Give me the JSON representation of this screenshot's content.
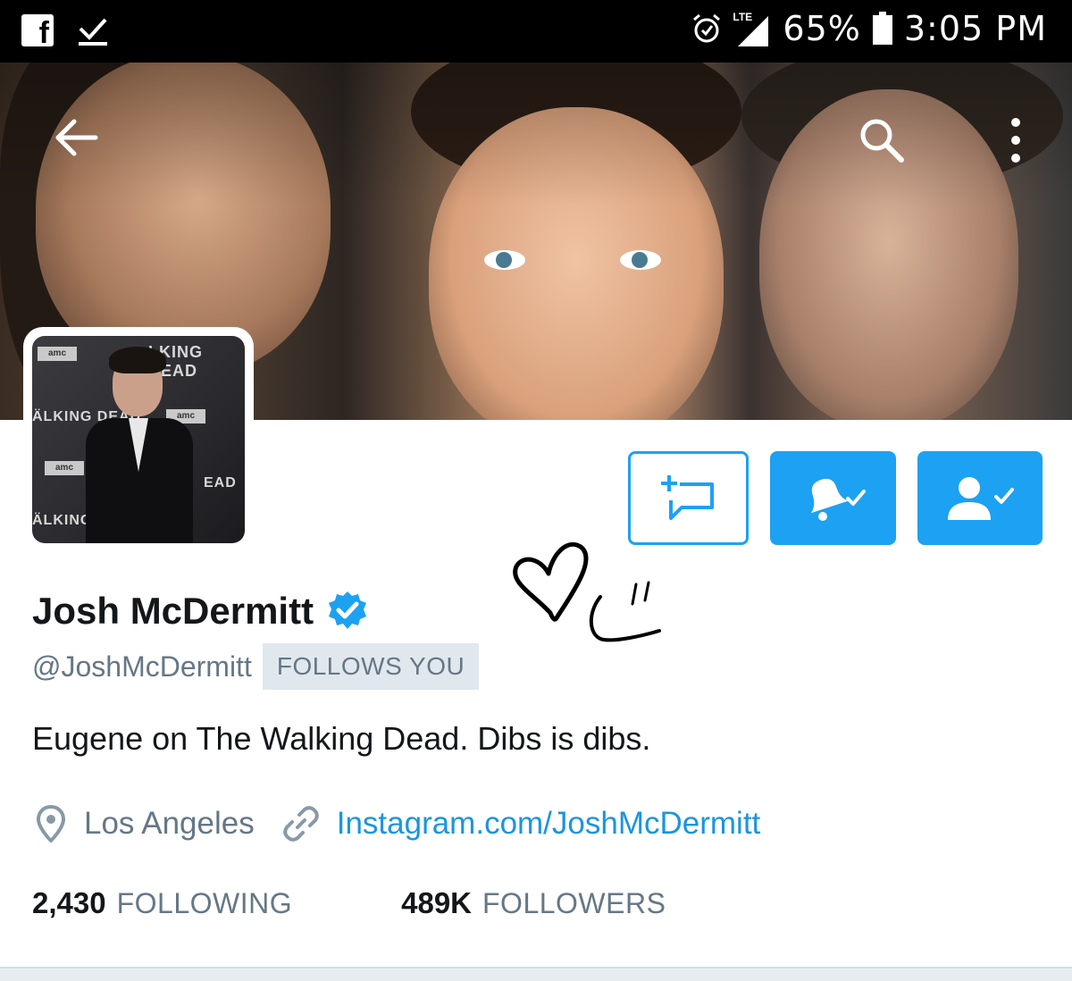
{
  "status_bar": {
    "network": "LTE",
    "battery": "65%",
    "time": "3:05 PM",
    "left_icons": [
      "facebook-icon",
      "download-icon"
    ],
    "right_icons": [
      "alarm-icon",
      "signal-icon",
      "battery-icon"
    ]
  },
  "header": {
    "back_icon": "arrow-left-icon",
    "search_icon": "search-icon",
    "more_icon": "more-vertical-icon",
    "avatar_banner_texts": [
      "amc",
      "LKING DEAD",
      "ÄLKING DEAD",
      "amc",
      "amc",
      "EAD",
      "ÄLKING D"
    ]
  },
  "actions": {
    "dm_icon": "new-message-icon",
    "notify_icon": "bell-check-icon",
    "following_icon": "user-check-icon",
    "accent_color": "#1da1f2"
  },
  "profile": {
    "display_name": "Josh McDermitt",
    "verified_icon": "verified-badge-icon",
    "handle": "@JoshMcDermitt",
    "follows_you": "FOLLOWS YOU",
    "bio": "Eugene on The Walking Dead. Dibs is dibs.",
    "location": "Los Angeles",
    "location_icon": "location-pin-icon",
    "link_icon": "link-icon",
    "website": "Instagram.com/JoshMcDermitt"
  },
  "stats": {
    "following_count": "2,430",
    "following_label": "FOLLOWING",
    "followers_count": "489K",
    "followers_label": "FOLLOWERS"
  }
}
